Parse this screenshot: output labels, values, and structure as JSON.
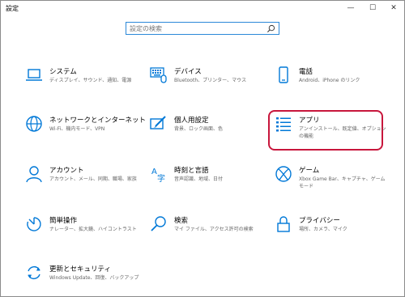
{
  "window": {
    "title": "設定",
    "minimize": "—",
    "maximize": "☐",
    "close": "✕"
  },
  "search": {
    "placeholder": "設定の検索"
  },
  "tiles": [
    {
      "name": "システム",
      "desc": "ディスプレイ、サウンド、通知、電源",
      "icon": "laptop-icon"
    },
    {
      "name": "デバイス",
      "desc": "Bluetooth、プリンター、マウス",
      "icon": "keyboard-icon"
    },
    {
      "name": "電話",
      "desc": "Android、iPhone のリンク",
      "icon": "phone-icon"
    },
    {
      "name": "ネットワークとインターネット",
      "desc": "Wi-Fi、機内モード、VPN",
      "icon": "globe-icon"
    },
    {
      "name": "個人用設定",
      "desc": "背景、ロック画面、色",
      "icon": "personalization-icon"
    },
    {
      "name": "アプリ",
      "desc": "アンインストール、既定値、オプションの機能",
      "icon": "apps-list-icon"
    },
    {
      "name": "アカウント",
      "desc": "アカウント、メール、同期、職場、家族",
      "icon": "person-icon"
    },
    {
      "name": "時刻と言語",
      "desc": "音声認識、地域、日付",
      "icon": "time-language-icon"
    },
    {
      "name": "ゲーム",
      "desc": "Xbox Game Bar、キャプチャ、ゲーム モード",
      "icon": "xbox-icon"
    },
    {
      "name": "簡単操作",
      "desc": "ナレーター、拡大鏡、ハイコントラスト",
      "icon": "ease-of-access-icon"
    },
    {
      "name": "検索",
      "desc": "マイ ファイル、アクセス許可の検索",
      "icon": "search-icon"
    },
    {
      "name": "プライバシー",
      "desc": "場所、カメラ、マイク",
      "icon": "lock-icon"
    },
    {
      "name": "更新とセキュリティ",
      "desc": "Windows Update、回復、バックアップ",
      "icon": "update-icon"
    }
  ],
  "colors": {
    "accent": "#0078d7",
    "highlight": "#c8163c"
  }
}
